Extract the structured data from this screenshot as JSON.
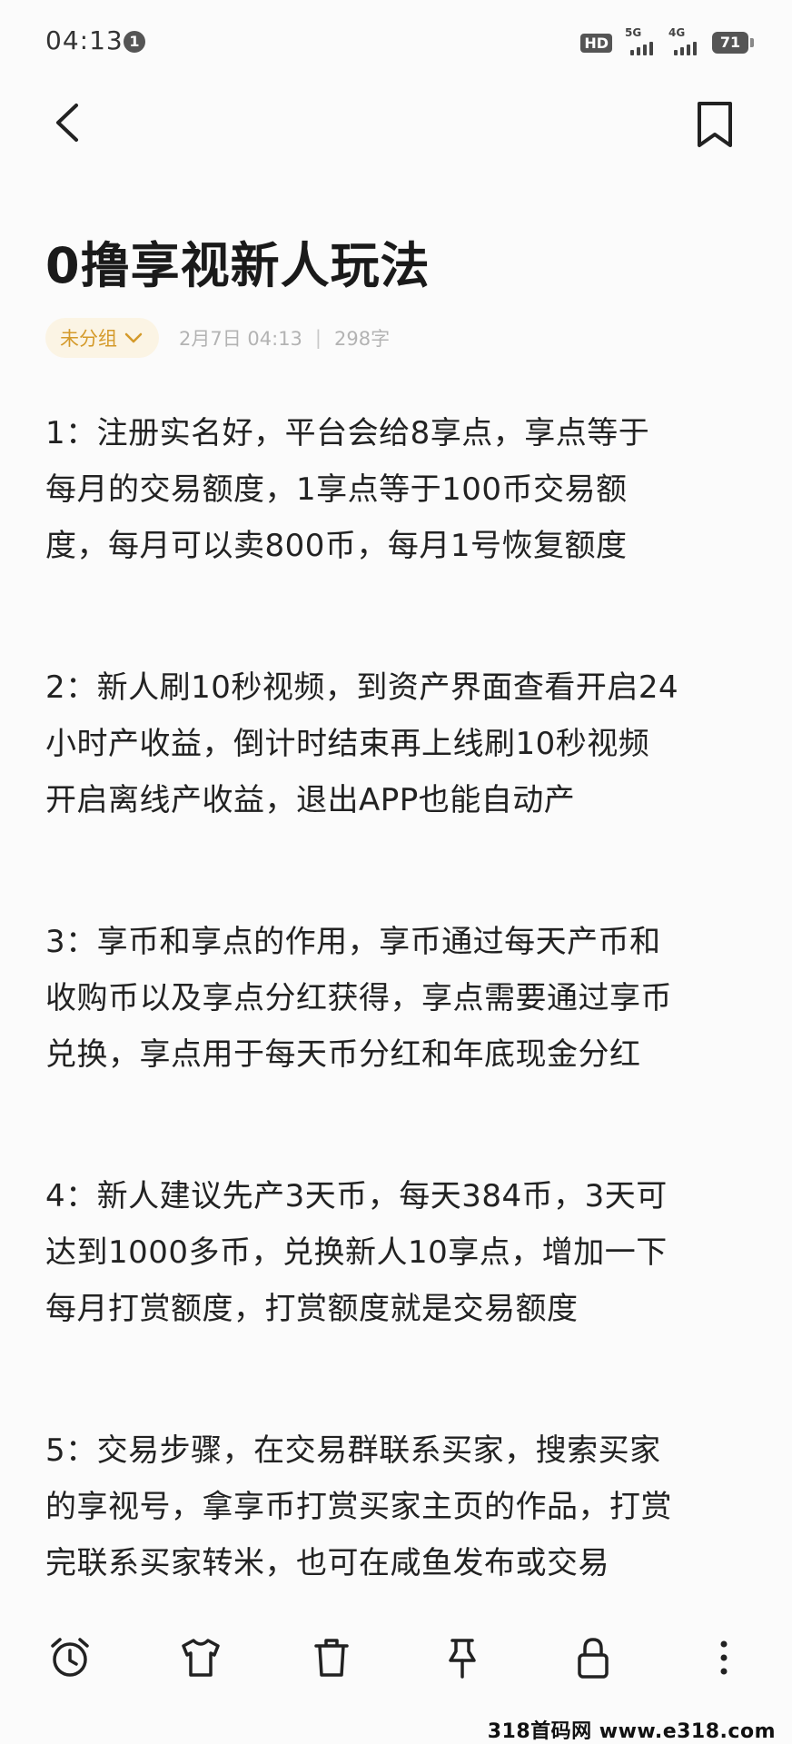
{
  "status_bar": {
    "time": "04:13",
    "notification_count": "1",
    "hd_label": "HD",
    "signal_1_label": "5G",
    "signal_2_label": "4G",
    "battery": "71"
  },
  "note": {
    "title": "0撸享视新人玩法",
    "group_label": "未分组",
    "date": "2月7日 04:13",
    "separator": "|",
    "word_count": "298字",
    "paragraphs": [
      {
        "lines": [
          "1：注册实名好，平台会给8享点，享点等于",
          "每月的交易额度，1享点等于100币交易额",
          "度，每月可以卖800币，每月1号恢复额度"
        ]
      },
      {
        "lines": [
          "2：新人刷10秒视频，到资产界面查看开启24",
          "小时产收益，倒计时结束再上线刷10秒视频",
          "开启离线产收益，退出APP也能自动产"
        ]
      },
      {
        "lines": [
          "3：享币和享点的作用，享币通过每天产币和",
          "收购币以及享点分红获得，享点需要通过享币",
          "兑换，享点用于每天币分红和年底现金分红"
        ]
      },
      {
        "lines": [
          "4：新人建议先产3天币，每天384币，3天可",
          "达到1000多币，兑换新人10享点，增加一下",
          "每月打赏额度，打赏额度就是交易额度"
        ]
      },
      {
        "lines": [
          "5：交易步骤，在交易群联系买家，搜索买家",
          "的享视号，拿享币打赏买家主页的作品，打赏",
          "完联系买家转米，也可在咸鱼发布或交易"
        ]
      }
    ]
  },
  "icons": {
    "back": "back-arrow-icon",
    "bookmark": "bookmark-icon",
    "alarm": "alarm-clock-icon",
    "shirt": "t-shirt-icon",
    "trash": "trash-icon",
    "pin": "pin-icon",
    "lock": "lock-icon",
    "more": "more-vertical-icon"
  },
  "colors": {
    "accent": "#d49a2a",
    "chip_bg": "#fbf4e4",
    "text": "#222222",
    "meta": "#b3b3b3"
  },
  "watermark": "318首码网 www.e318.com"
}
